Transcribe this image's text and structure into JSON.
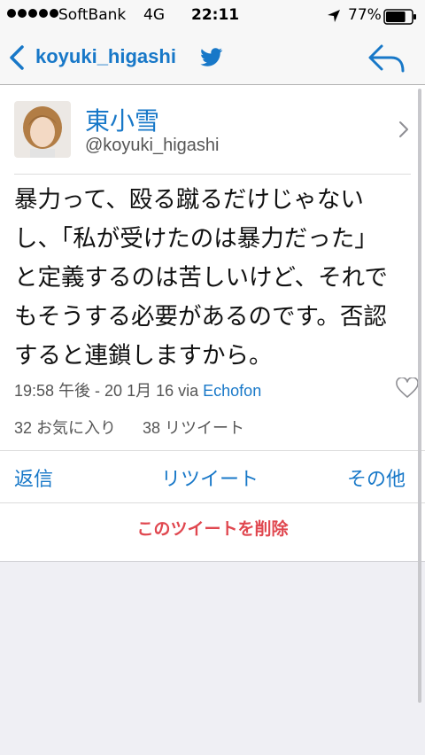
{
  "status_bar": {
    "carrier": "SoftBank",
    "network": "4G",
    "time": "22:11",
    "battery": "77%",
    "battery_level": 0.77
  },
  "nav": {
    "title": "koyuki_higashi",
    "back_icon": "chevron-left-icon",
    "reply_icon": "reply-arrow-icon",
    "bird_icon": "twitter-bird-icon"
  },
  "tweet": {
    "display_name": "東小雪",
    "handle": "@koyuki_higashi",
    "text": "暴力って、殴る蹴るだけじゃない\nし、「私が受けたのは暴力だった」\nと定義するのは苦しいけど、それで\nもそうする必要があるのです。否認\nすると連鎖しますから。",
    "timestamp": "19:58 午後 - 20 1月 16",
    "via_label": "via",
    "via_app": "Echofon",
    "likes": "32 お気に入り",
    "retweets": "38 リツイート"
  },
  "actions": {
    "reply": "返信",
    "retweet": "リツイート",
    "other": "その他",
    "delete": "このツイートを削除"
  },
  "colors": {
    "accent": "#1878c8",
    "delete": "#e0474f",
    "background": "#efeff4"
  }
}
